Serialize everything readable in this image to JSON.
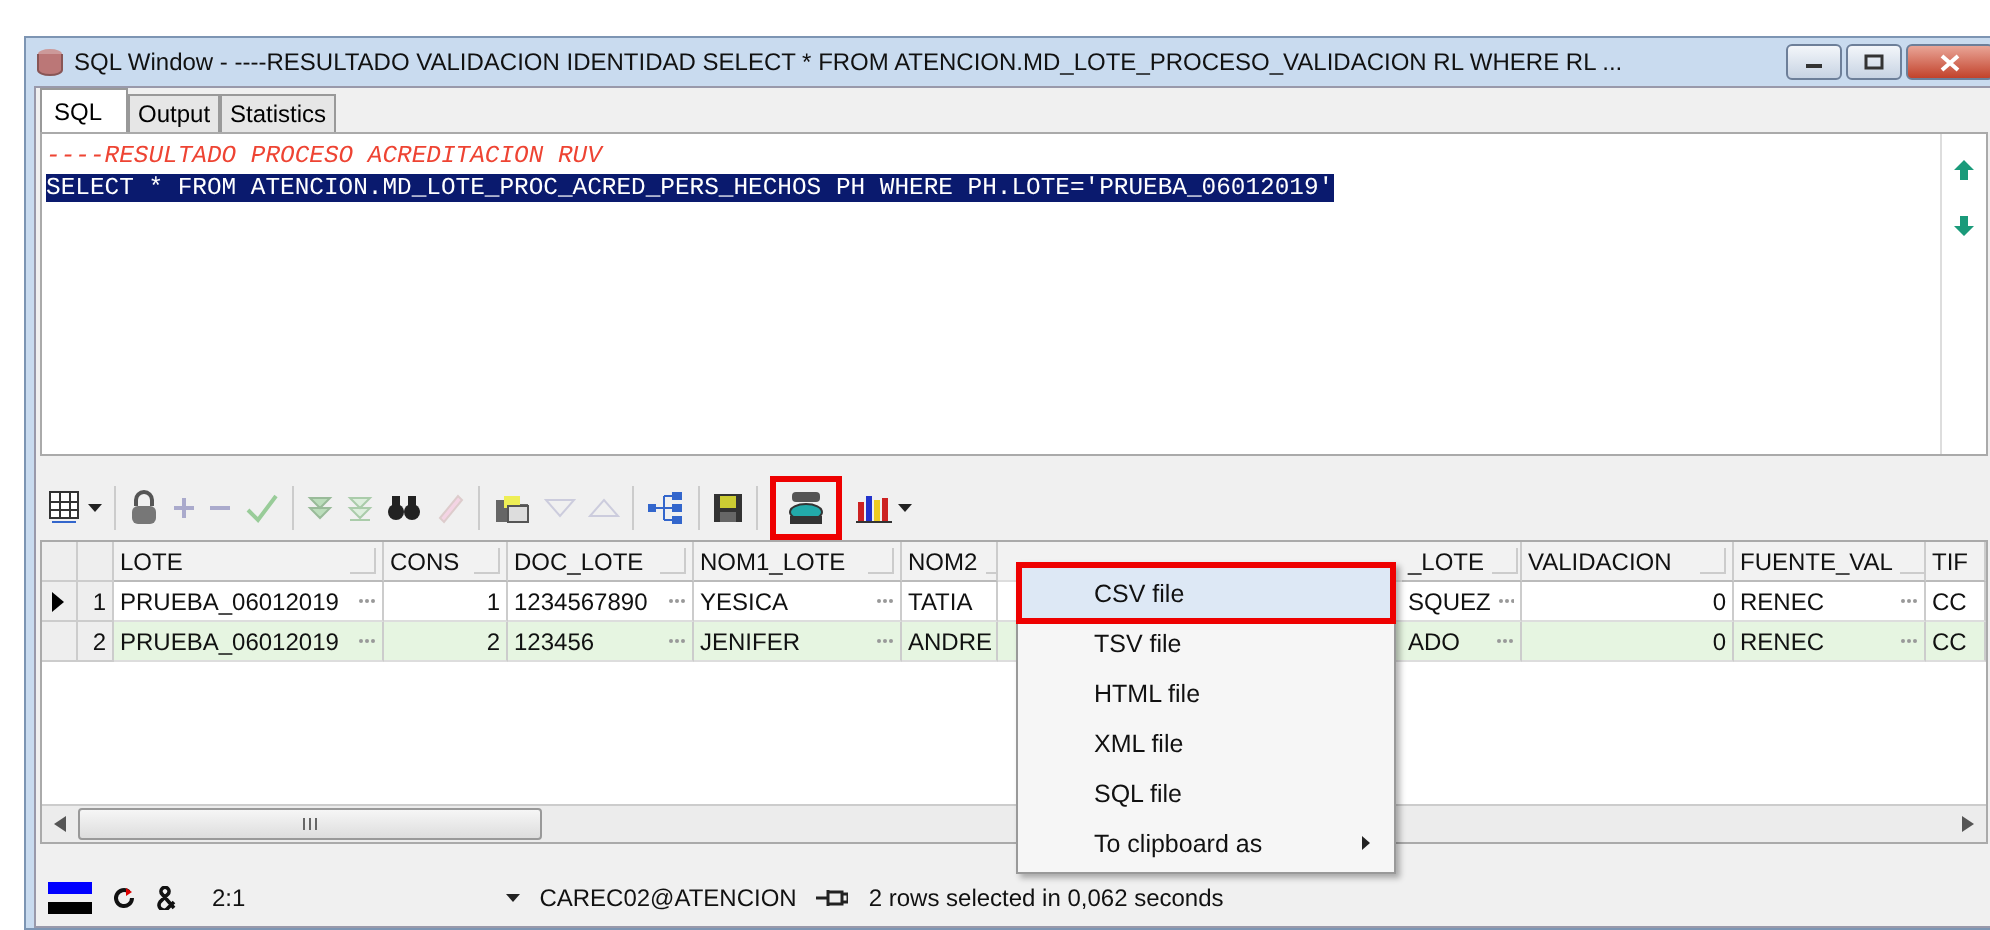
{
  "window": {
    "title": "SQL Window - ----RESULTADO VALIDACION IDENTIDAD SELECT * FROM ATENCION.MD_LOTE_PROCESO_VALIDACION RL WHERE RL ..."
  },
  "tabs": [
    {
      "label": "SQL",
      "selected": true
    },
    {
      "label": "Output",
      "selected": false
    },
    {
      "label": "Statistics",
      "selected": false
    }
  ],
  "editor": {
    "lines": [
      {
        "kind": "comment",
        "text": "----RESULTADO PROCESO ACREDITACION RUV",
        "selected": false
      },
      {
        "kind": "code",
        "text": "SELECT * FROM ATENCION.MD_LOTE_PROC_ACRED_PERS_HECHOS PH WHERE PH.LOTE='PRUEBA_06012019'",
        "selected": true
      }
    ]
  },
  "toolbar": {
    "export_highlighted": true
  },
  "grid": {
    "columns": [
      {
        "label": "LOTE"
      },
      {
        "label": "CONS"
      },
      {
        "label": "DOC_LOTE"
      },
      {
        "label": "NOM1_LOTE"
      },
      {
        "label": "NOM2"
      },
      {
        "label": "_LOTE"
      },
      {
        "label": "VALIDACION"
      },
      {
        "label": "FUENTE_VAL"
      },
      {
        "label": "TIF"
      }
    ],
    "rows": [
      {
        "number": "1",
        "current": true,
        "cells": [
          "PRUEBA_06012019",
          "1",
          "1234567890",
          "YESICA",
          "TATIA",
          "SQUEZ",
          "0",
          "RENEC",
          "CC"
        ]
      },
      {
        "number": "2",
        "current": false,
        "cells": [
          "PRUEBA_06012019",
          "2",
          "123456",
          "JENIFER",
          "ANDRE",
          "ADO",
          "0",
          "RENEC",
          "CC"
        ]
      }
    ]
  },
  "menu": {
    "items": [
      {
        "label": "CSV file",
        "selected": true,
        "submenu": false
      },
      {
        "label": "TSV file",
        "selected": false,
        "submenu": false
      },
      {
        "label": "HTML file",
        "selected": false,
        "submenu": false
      },
      {
        "label": "XML file",
        "selected": false,
        "submenu": false
      },
      {
        "label": "SQL file",
        "selected": false,
        "submenu": false
      },
      {
        "label": "To clipboard as",
        "selected": false,
        "submenu": true
      }
    ]
  },
  "status_bar": {
    "position": "2:1",
    "connection": "CAREC02@ATENCION",
    "message": "2 rows selected in 0,062 seconds"
  }
}
